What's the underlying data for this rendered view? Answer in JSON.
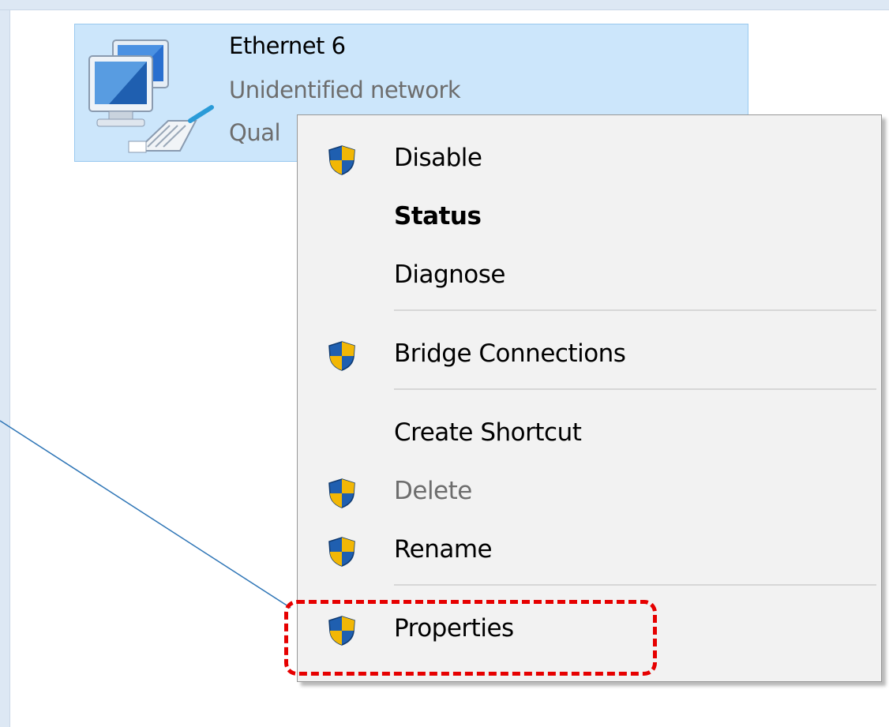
{
  "adapter": {
    "name": "Ethernet 6",
    "status": "Unidentified network",
    "device": "Qual"
  },
  "context_menu": {
    "items": [
      {
        "label": "Disable",
        "shield": true,
        "style": "normal"
      },
      {
        "label": "Status",
        "shield": false,
        "style": "bold"
      },
      {
        "label": "Diagnose",
        "shield": false,
        "style": "normal"
      },
      {
        "separator": true
      },
      {
        "label": "Bridge Connections",
        "shield": true,
        "style": "normal"
      },
      {
        "separator": true
      },
      {
        "label": "Create Shortcut",
        "shield": false,
        "style": "normal"
      },
      {
        "label": "Delete",
        "shield": true,
        "style": "disabled"
      },
      {
        "label": "Rename",
        "shield": true,
        "style": "normal"
      },
      {
        "separator": true
      },
      {
        "label": "Properties",
        "shield": true,
        "style": "normal",
        "highlighted": true
      }
    ]
  },
  "colors": {
    "tile_selected_bg": "#cce6fb",
    "tile_selected_border": "#99c9ef",
    "menu_bg": "#f2f2f2",
    "highlight": "#e60000",
    "callout_line": "#2e75b6",
    "shield_blue": "#1f5fb0",
    "shield_yellow": "#f2b705"
  },
  "icons": {
    "adapter": "network-adapter-icon",
    "shield": "uac-shield-icon"
  }
}
